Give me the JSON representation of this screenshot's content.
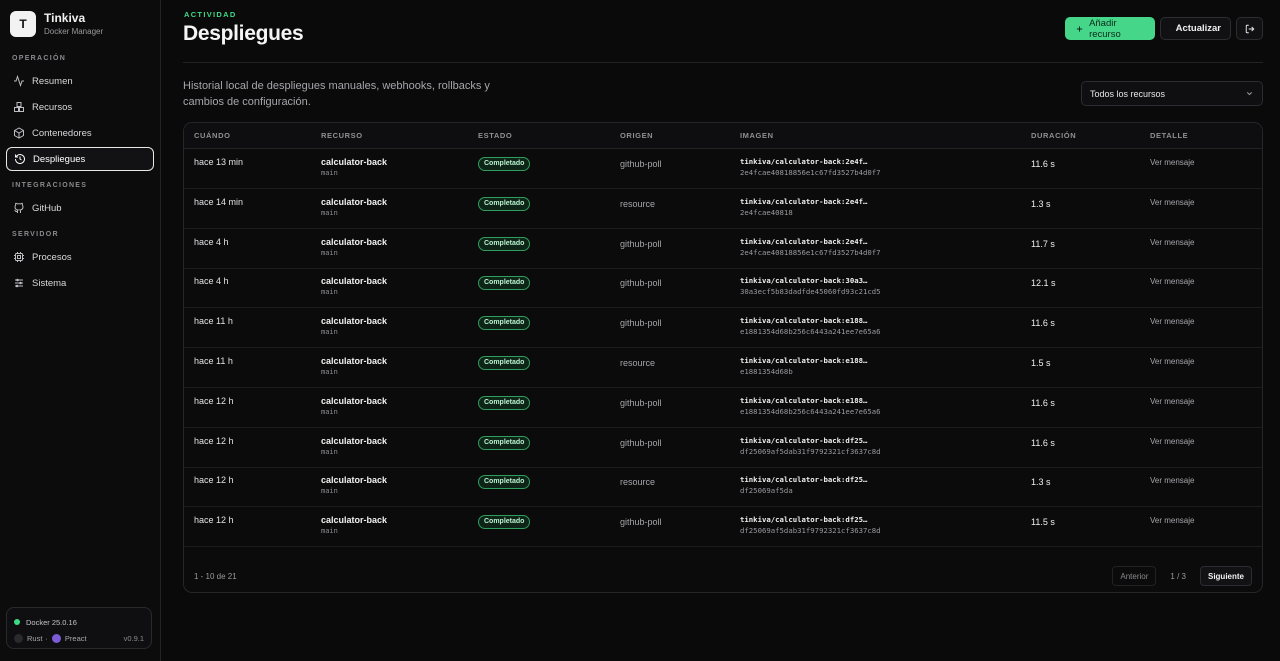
{
  "brand": {
    "initial": "T",
    "name": "Tinkiva",
    "subtitle": "Docker Manager"
  },
  "sidebar": {
    "sections": [
      {
        "label": "OPERACIÓN",
        "items": [
          {
            "label": "Resumen",
            "icon": "activity-icon"
          },
          {
            "label": "Recursos",
            "icon": "boxes-icon"
          },
          {
            "label": "Contenedores",
            "icon": "container-icon"
          },
          {
            "label": "Despliegues",
            "icon": "history-icon",
            "active": true
          }
        ]
      },
      {
        "label": "INTEGRACIONES",
        "items": [
          {
            "label": "GitHub",
            "icon": "github-icon"
          }
        ]
      },
      {
        "label": "SERVIDOR",
        "items": [
          {
            "label": "Procesos",
            "icon": "cpu-icon"
          },
          {
            "label": "Sistema",
            "icon": "sliders-icon"
          }
        ]
      }
    ],
    "footer": {
      "docker": "Docker 25.0.16",
      "stack_a": "Rust",
      "sep": "·",
      "stack_b": "Preact",
      "version": "v0.9.1"
    }
  },
  "header": {
    "eyebrow": "ACTIVIDAD",
    "title": "Despliegues",
    "add_label": "Añadir recurso",
    "refresh_label": "Actualizar"
  },
  "description": "Historial local de despliegues manuales, webhooks, rollbacks y cambios de configuración.",
  "filter": {
    "selected": "Todos los recursos"
  },
  "table": {
    "columns": [
      "CUÁNDO",
      "RECURSO",
      "ESTADO",
      "ORIGEN",
      "IMAGEN",
      "DURACIÓN",
      "DETALLE"
    ],
    "rows": [
      {
        "when": "hace 13 min",
        "resource": "calculator-back",
        "branch": "main",
        "status": "Completado",
        "origin": "github-poll",
        "image": "tinkiva/calculator-back:2e4f…",
        "hash": "2e4fcae40818856e1c67fd3527b4d0f7",
        "duration": "11.6 s",
        "detail": "Ver mensaje"
      },
      {
        "when": "hace 14 min",
        "resource": "calculator-back",
        "branch": "main",
        "status": "Completado",
        "origin": "resource",
        "image": "tinkiva/calculator-back:2e4f…",
        "hash": "2e4fcae40818",
        "duration": "1.3 s",
        "detail": "Ver mensaje"
      },
      {
        "when": "hace 4 h",
        "resource": "calculator-back",
        "branch": "main",
        "status": "Completado",
        "origin": "github-poll",
        "image": "tinkiva/calculator-back:2e4f…",
        "hash": "2e4fcae40818856e1c67fd3527b4d0f7",
        "duration": "11.7 s",
        "detail": "Ver mensaje"
      },
      {
        "when": "hace 4 h",
        "resource": "calculator-back",
        "branch": "main",
        "status": "Completado",
        "origin": "github-poll",
        "image": "tinkiva/calculator-back:30a3…",
        "hash": "30a3ecf5b83dadfde45060fd93c21cd5",
        "duration": "12.1 s",
        "detail": "Ver mensaje"
      },
      {
        "when": "hace 11 h",
        "resource": "calculator-back",
        "branch": "main",
        "status": "Completado",
        "origin": "github-poll",
        "image": "tinkiva/calculator-back:e188…",
        "hash": "e1881354d68b256c6443a241ee7e65a6",
        "duration": "11.6 s",
        "detail": "Ver mensaje"
      },
      {
        "when": "hace 11 h",
        "resource": "calculator-back",
        "branch": "main",
        "status": "Completado",
        "origin": "resource",
        "image": "tinkiva/calculator-back:e188…",
        "hash": "e1881354d68b",
        "duration": "1.5 s",
        "detail": "Ver mensaje"
      },
      {
        "when": "hace 12 h",
        "resource": "calculator-back",
        "branch": "main",
        "status": "Completado",
        "origin": "github-poll",
        "image": "tinkiva/calculator-back:e188…",
        "hash": "e1881354d68b256c6443a241ee7e65a6",
        "duration": "11.6 s",
        "detail": "Ver mensaje"
      },
      {
        "when": "hace 12 h",
        "resource": "calculator-back",
        "branch": "main",
        "status": "Completado",
        "origin": "github-poll",
        "image": "tinkiva/calculator-back:df25…",
        "hash": "df25069af5dab31f9792321cf3637c8d",
        "duration": "11.6 s",
        "detail": "Ver mensaje"
      },
      {
        "when": "hace 12 h",
        "resource": "calculator-back",
        "branch": "main",
        "status": "Completado",
        "origin": "resource",
        "image": "tinkiva/calculator-back:df25…",
        "hash": "df25069af5da",
        "duration": "1.3 s",
        "detail": "Ver mensaje"
      },
      {
        "when": "hace 12 h",
        "resource": "calculator-back",
        "branch": "main",
        "status": "Completado",
        "origin": "github-poll",
        "image": "tinkiva/calculator-back:df25…",
        "hash": "df25069af5dab31f9792321cf3637c8d",
        "duration": "11.5 s",
        "detail": "Ver mensaje"
      }
    ]
  },
  "pagination": {
    "range": "1 - 10 de 21",
    "prev": "Anterior",
    "page": "1 / 3",
    "next": "Siguiente"
  },
  "colors": {
    "accent": "#45d68a",
    "badge_border": "#2f9e5e",
    "background": "#0a0a0b"
  }
}
